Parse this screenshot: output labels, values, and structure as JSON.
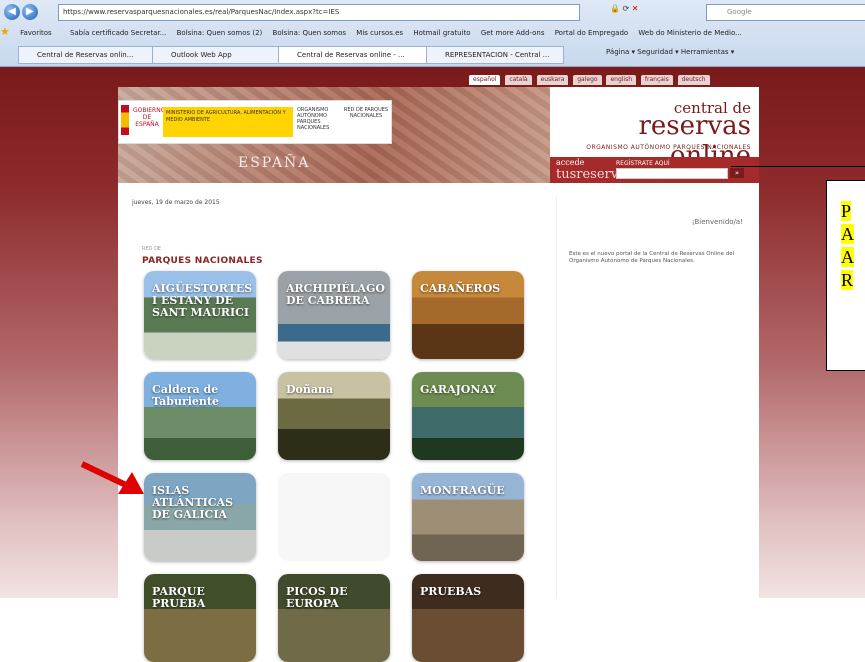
{
  "browser": {
    "url": "https://www.reservasparquesnacionales.es/real/ParquesNac/Index.aspx?tc=IES",
    "search_placeholder": "Google",
    "addr_tools": "",
    "favorites_label": "Favoritos",
    "favorites": [
      "Sabía certificado Secretar...",
      "Bolsina: Quen somos (2)",
      "Bolsina: Quen somos",
      "Mis cursos.es",
      "Hotmail gratuito",
      "Get more Add-ons",
      "Portal do Empregado",
      "Web do Ministerio de Medio..."
    ],
    "tabs": [
      {
        "label": "Central de Reservas onlin...",
        "active": false
      },
      {
        "label": "Outlook Web App",
        "active": false
      },
      {
        "label": "Central de Reservas online - ...",
        "active": true
      },
      {
        "label": "REPRESENTACION - Central ...",
        "active": false
      }
    ],
    "tab_tools": "Página ▾   Seguridad ▾   Herramientas ▾"
  },
  "site": {
    "languages": [
      "español",
      "català",
      "euskara",
      "galego",
      "english",
      "français",
      "deutsch"
    ],
    "active_language": "español",
    "brand_top": "central de",
    "brand_main": "reservas online",
    "brand_sub": "ORGANISMO AUTÓNOMO PARQUES NACIONALES",
    "gov": {
      "gobierno": "GOBIERNO DE ESPAÑA",
      "ministerio": "MINISTERIO DE AGRICULTURA, ALIMENTACIÓN Y MEDIO AMBIENTE",
      "oapn": "ORGANISMO AUTÓNOMO PARQUES NACIONALES",
      "parques": "RED DE PARQUES NACIONALES"
    },
    "banner_text": "ESPAÑA",
    "login": {
      "accede": "accede",
      "tus": "tusreservas",
      "label": "REGÍSTRATE AQUÍ",
      "go": "»"
    },
    "date": "jueves, 19 de marzo de 2015",
    "welcome": "¡Bienvenido/a!",
    "welcome_body": "Este es el nuevo portal de la Central de Reservas Online del Organismo Autónomo de Parques Nacionales.",
    "section_sub": "RED DE",
    "section_title": "PARQUES NACIONALES",
    "parks": [
      {
        "name": "AIGÜESTORTES I ESTANY DE SANT MAURICI",
        "style": "upper"
      },
      {
        "name": "ARCHIPIÉLAGO DE CABRERA",
        "style": "upper"
      },
      {
        "name": "CABAÑEROS",
        "style": "upper"
      },
      {
        "name": "Caldera de Taburiente",
        "style": "plain"
      },
      {
        "name": "Doñana",
        "style": "plain"
      },
      {
        "name": "GARAJONAY",
        "style": "upper"
      },
      {
        "name": "ISLAS ATLÁNTICAS DE GALICIA",
        "style": "upper"
      },
      {
        "name": "",
        "style": "empty"
      },
      {
        "name": "MONFRAGÜE",
        "style": "upper"
      },
      {
        "name": "PARQUE PRUEBA",
        "style": "upper"
      },
      {
        "name": "PICOS DE EUROPA",
        "style": "upper"
      },
      {
        "name": "PRUEBAS",
        "style": "upper"
      }
    ]
  },
  "annotation": {
    "lines": [
      "P",
      "A",
      "A",
      "R"
    ],
    "highlight": "#ffff00",
    "arrow_color": "#e00000"
  }
}
